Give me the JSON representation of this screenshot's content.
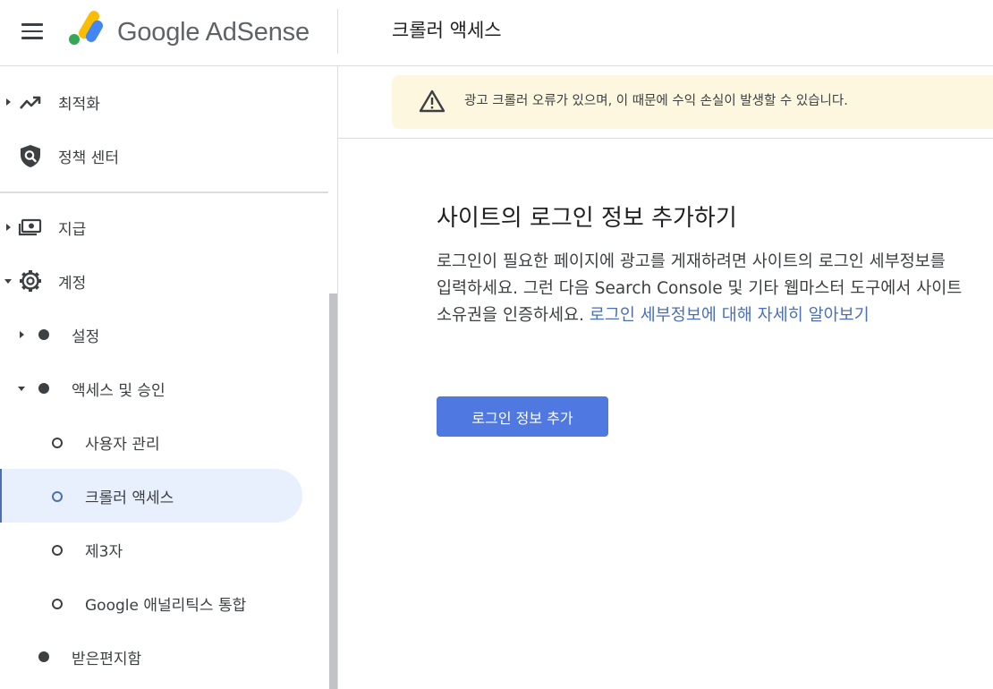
{
  "header": {
    "brand": "Google AdSense",
    "title": "크롤러 액세스"
  },
  "sidebar": {
    "items": [
      {
        "label": "최적화",
        "icon": "trending-up-icon"
      },
      {
        "label": "정책 센터",
        "icon": "policy-shield-icon"
      },
      {
        "label": "지급",
        "icon": "payments-icon"
      },
      {
        "label": "계정",
        "icon": "gear-icon"
      },
      {
        "label": "설정"
      },
      {
        "label": "액세스 및 승인"
      },
      {
        "label": "사용자 관리"
      },
      {
        "label": "크롤러 액세스"
      },
      {
        "label": "제3자"
      },
      {
        "label": "Google 애널리틱스 통합"
      },
      {
        "label": "받은편지함"
      }
    ],
    "active_item": "크롤러 액세스"
  },
  "banner": {
    "text": "광고 크롤러 오류가 있으며, 이 때문에 수익 손실이 발생할 수 있습니다.",
    "icon": "warning-icon"
  },
  "main": {
    "title": "사이트의 로그인 정보 추가하기",
    "body": "로그인이 필요한 페이지에 광고를 게재하려면 사이트의 로그인 세부정보를 입력하세요. 그런 다음 Search Console 및 기타 웹마스터 도구에서 사이트 소유권을 인증하세요. ",
    "link": "로그인 세부정보에 대해 자세히 알아보기",
    "button_label": "로그인 정보 추가"
  },
  "colors": {
    "accent": "#4f78e0",
    "link": "#4a6fb5",
    "banner_bg": "#fef7e0",
    "active_bg": "#e8f0fe"
  }
}
